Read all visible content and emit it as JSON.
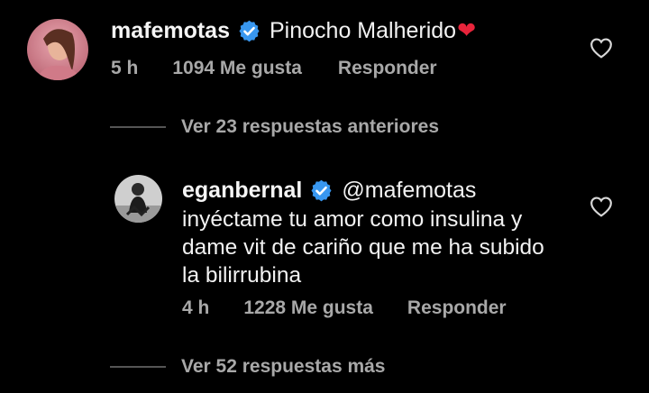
{
  "comments": [
    {
      "username": "mafemotas",
      "text": "Pinocho Malherido",
      "emoji": "❤",
      "time": "5 h",
      "likes": "1094 Me gusta",
      "reply_label": "Responder"
    },
    {
      "username": "eganbernal",
      "mention": "@mafemotas",
      "lines": [
        "inyéctame tu amor como insulina y",
        "dame vit de cariño que me ha subido",
        "la bilirrubina"
      ],
      "time": "4 h",
      "likes": "1228 Me gusta",
      "reply_label": "Responder"
    }
  ],
  "threads": {
    "previous_replies": "Ver 23 respuestas anteriores",
    "more_replies": "Ver 52 respuestas más"
  },
  "icons": {
    "verified": "verified-badge-icon",
    "like": "heart-outline-icon"
  },
  "colors": {
    "verified": "#3897f0",
    "emoji_heart": "#e8243b",
    "muted": "#a8a8a8"
  }
}
